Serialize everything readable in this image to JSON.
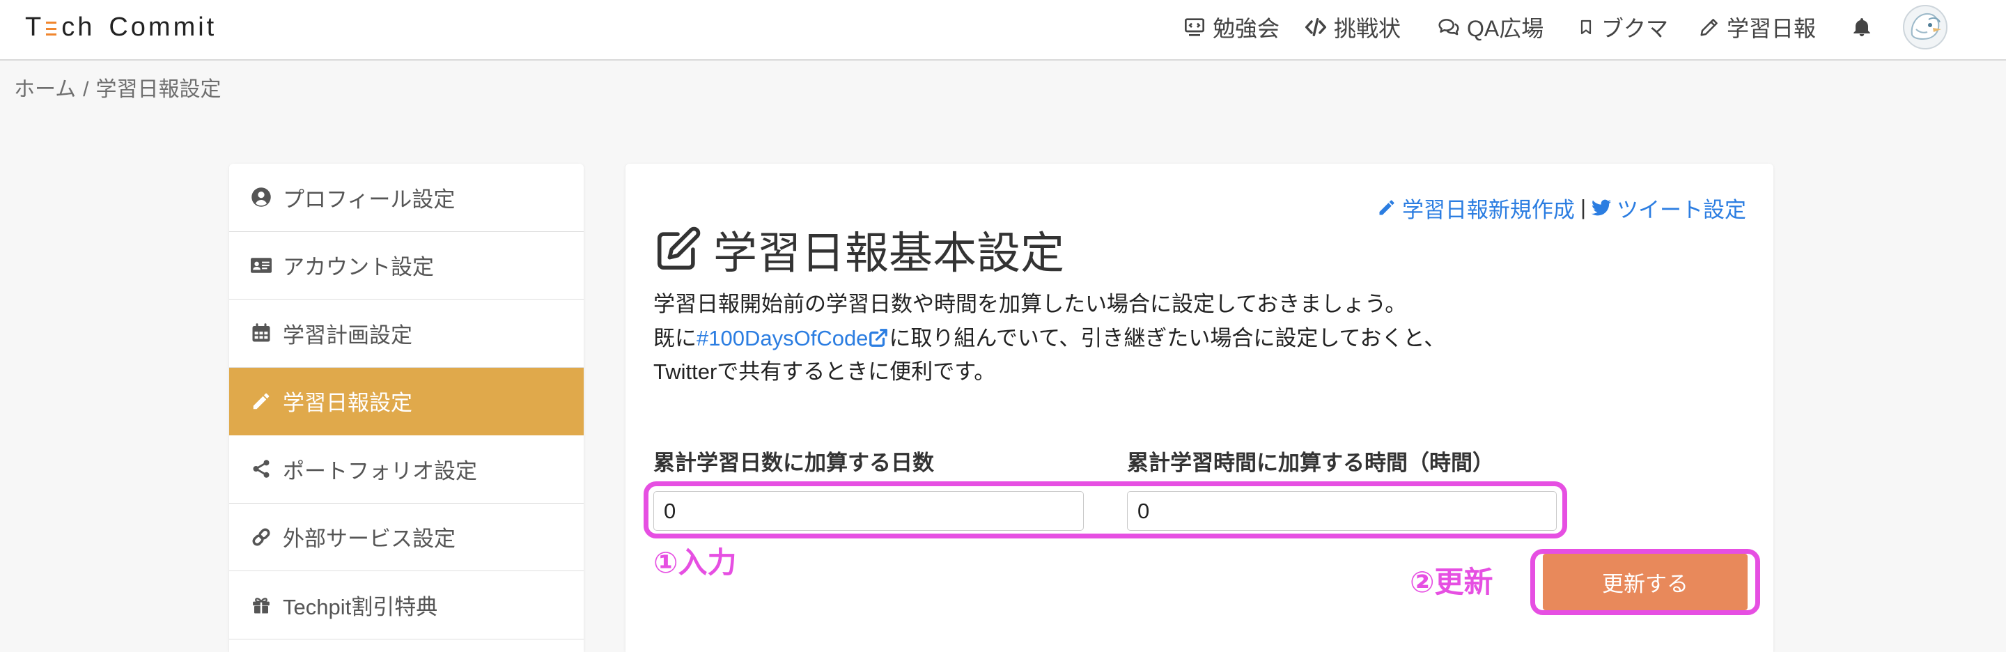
{
  "header": {
    "logo": {
      "t": "T",
      "ch": "ch",
      "commit": "Commit",
      "accent_color": "#f0862e"
    },
    "nav": [
      {
        "label": "勉強会",
        "icon": "chalkboard-icon"
      },
      {
        "label": "挑戦状",
        "icon": "code-icon"
      },
      {
        "label": "QA広場",
        "icon": "comments-icon"
      },
      {
        "label": "ブクマ",
        "icon": "bookmark-icon"
      },
      {
        "label": "学習日報",
        "icon": "pencil-icon"
      }
    ],
    "notification_icon": "bell-icon",
    "avatar_icon": "avatar"
  },
  "breadcrumb": {
    "home": "ホーム",
    "separator": "/",
    "current": "学習日報設定"
  },
  "sidebar": {
    "items": [
      {
        "label": "プロフィール設定",
        "icon": "user-circle-icon",
        "active": false
      },
      {
        "label": "アカウント設定",
        "icon": "id-card-icon",
        "active": false
      },
      {
        "label": "学習計画設定",
        "icon": "calendar-icon",
        "active": false
      },
      {
        "label": "学習日報設定",
        "icon": "pencil-icon",
        "active": true
      },
      {
        "label": "ポートフォリオ設定",
        "icon": "share-icon",
        "active": false
      },
      {
        "label": "外部サービス設定",
        "icon": "link-icon",
        "active": false
      },
      {
        "label": "Techpit割引特典",
        "icon": "gift-icon",
        "active": false
      }
    ]
  },
  "main": {
    "links": {
      "new_report": "学習日報新規作成",
      "divider": "|",
      "tweet_settings": "ツイート設定"
    },
    "title": "学習日報基本設定",
    "description": {
      "line1": "学習日報開始前の学習日数や時間を加算したい場合に設定しておきましょう。",
      "line2_prefix": "既に",
      "hashtag_link": "#100DaysOfCode",
      "line2_suffix": "に取り組んでいて、引き継ぎたい場合に設定しておくと、",
      "line3": "Twitterで共有するときに便利です。"
    },
    "form": {
      "days_label": "累計学習日数に加算する日数",
      "days_value": "0",
      "hours_label": "累計学習時間に加算する時間（時間）",
      "hours_value": "0",
      "submit_label": "更新する"
    }
  },
  "annotations": {
    "step1": "①入力",
    "step2": "②更新",
    "color": "#e64fe2"
  },
  "colors": {
    "active_item": "#e0a94b",
    "button": "#e8895b",
    "link": "#2b7de1"
  }
}
